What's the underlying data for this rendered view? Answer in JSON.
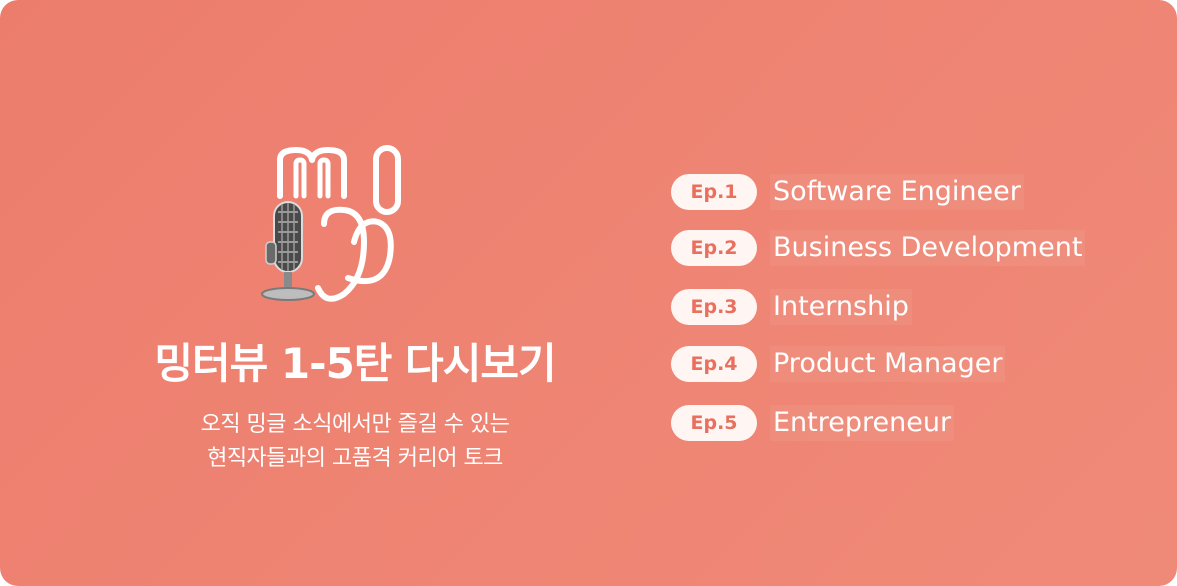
{
  "colors": {
    "background": "#ee8372",
    "badge_bg": "#fff6f3",
    "badge_text": "#e9705f",
    "text": "#ffffff"
  },
  "icons": {
    "logo": "mingle-logo-icon",
    "microphone": "microphone-icon"
  },
  "title": "밍터뷰 1-5탄 다시보기",
  "subtitle": {
    "line1": "오직 밍글 소식에서만 즐길 수 있는",
    "line2": "현직자들과의 고품격 커리어 토크"
  },
  "episodes": [
    {
      "badge": "Ep.1",
      "name": "Software Engineer"
    },
    {
      "badge": "Ep.2",
      "name": "Business Development"
    },
    {
      "badge": "Ep.3",
      "name": "Internship"
    },
    {
      "badge": "Ep.4",
      "name": "Product Manager"
    },
    {
      "badge": "Ep.5",
      "name": "Entrepreneur"
    }
  ]
}
